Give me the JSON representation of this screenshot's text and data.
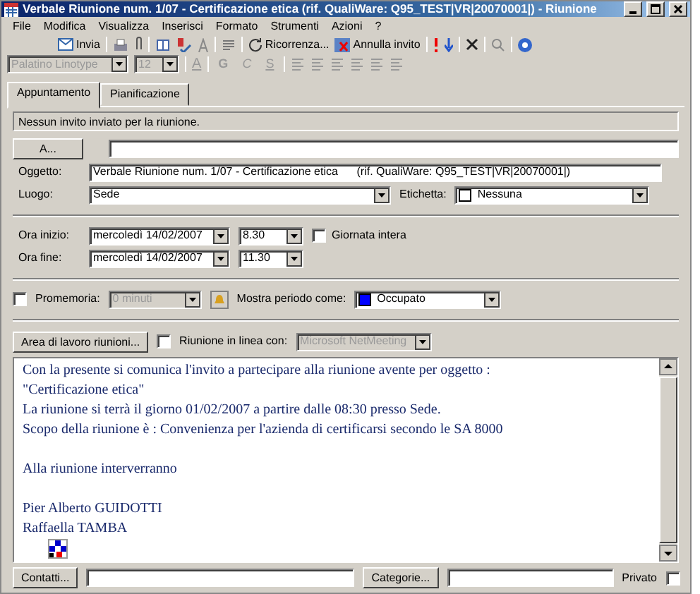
{
  "window": {
    "title": "Verbale Riunione num. 1/07 - Certificazione etica      (rif. QualiWare: Q95_TEST|VR|20070001|) - Riunione"
  },
  "menu": [
    "File",
    "Modifica",
    "Visualizza",
    "Inserisci",
    "Formato",
    "Strumenti",
    "Azioni",
    "?"
  ],
  "toolbar": {
    "send": "Invia",
    "recurrence": "Ricorrenza...",
    "cancel_invite": "Annulla invito"
  },
  "format_toolbar": {
    "font": "Palatino Linotype",
    "size": "12",
    "bold": "G",
    "italic": "C",
    "underline": "S",
    "text_color": "A",
    "disabled": true
  },
  "tabs": [
    {
      "label": "Appuntamento",
      "selected": true
    },
    {
      "label": "Pianificazione",
      "selected": false
    }
  ],
  "info": "Nessun invito inviato per la riunione.",
  "to": {
    "button": "A..."
  },
  "subject": {
    "label": "Oggetto:",
    "value": "Verbale Riunione num. 1/07 - Certificazione etica      (rif. QualiWare: Q95_TEST|VR|20070001|)"
  },
  "location": {
    "label": "Luogo:",
    "value": "Sede"
  },
  "tag": {
    "label": "Etichetta:",
    "value": "Nessuna"
  },
  "start": {
    "label": "Ora inizio:",
    "date": "mercoledì 14/02/2007",
    "time": "8.30"
  },
  "all_day": {
    "label": "Giornata intera",
    "checked": false
  },
  "end": {
    "label": "Ora fine:",
    "date": "mercoledì 14/02/2007",
    "time": "11.30"
  },
  "reminder": {
    "label": "Promemoria:",
    "checked": false,
    "value": "0 minuti",
    "disabled": true
  },
  "show_as": {
    "label": "Mostra periodo come:",
    "value": "Occupato",
    "color": "#0000ff"
  },
  "online": {
    "button": "Area di lavoro riunioni...",
    "label": "Riunione in linea con:",
    "checked": false,
    "value": "Microsoft NetMeeting",
    "disabled": true
  },
  "body": {
    "paragraphs": [
      {
        "lines": [
          "Con la presente si comunica l'invito a partecipare alla riunione avente per oggetto :",
          "\"Certificazione etica\"",
          "La riunione si terrà il giorno 01/02/2007 a partire dalle 08:30 presso Sede.",
          "Scopo della riunione è : Convenienza per l'azienda di certificarsi secondo le SA 8000"
        ]
      },
      {
        "lines": [
          "Alla riunione interverranno"
        ]
      },
      {
        "lines": [
          "Pier Alberto GUIDOTTI",
          "Raffaella TAMBA"
        ]
      }
    ]
  },
  "footer": {
    "contacts": "Contatti...",
    "categories": "Categorie...",
    "private_label": "Privato",
    "private": false
  }
}
